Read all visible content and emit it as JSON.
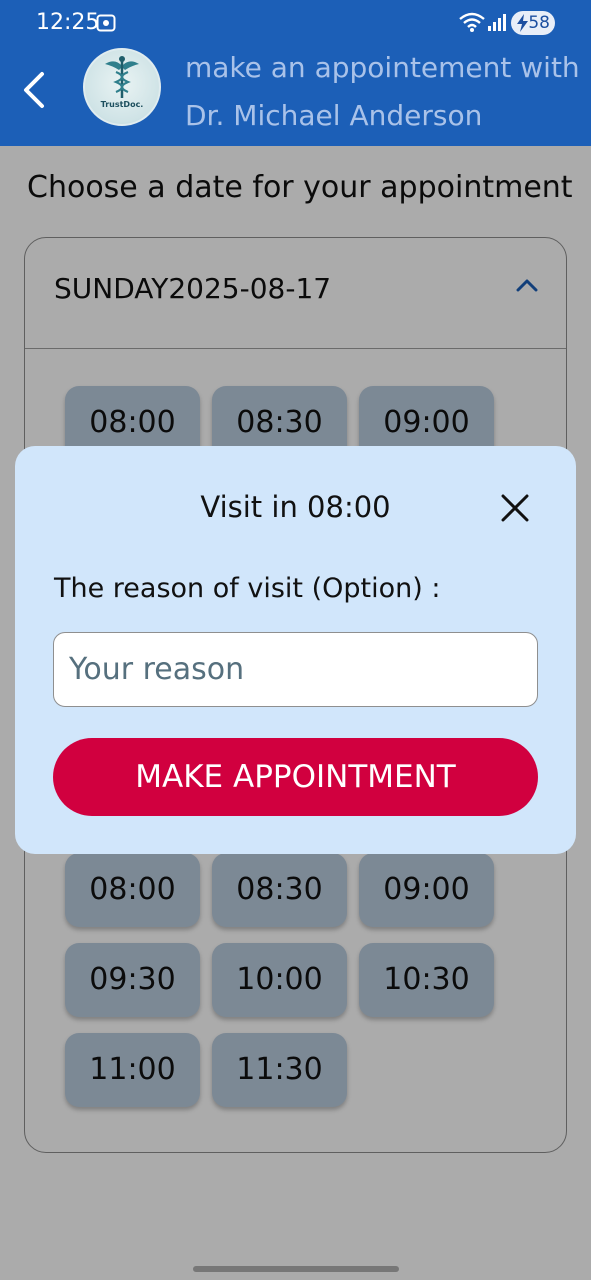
{
  "status_bar": {
    "time": "12:25",
    "battery": "58"
  },
  "app_bar": {
    "title_line1": "make an appointement with",
    "title_line2": "Dr. Michael Anderson",
    "logo_text": "TrustDoc."
  },
  "page": {
    "heading": "Choose a date for your appointment",
    "date_header": "SUNDAY2025-08-17",
    "top_slots": [
      "08:00",
      "08:30",
      "09:00"
    ],
    "slots": [
      "08:00",
      "08:30",
      "09:00",
      "09:30",
      "10:00",
      "10:30",
      "11:00",
      "11:30"
    ]
  },
  "dialog": {
    "title": "Visit in 08:00",
    "reason_label": "The reason of visit (Option) :",
    "reason_placeholder": "Your reason",
    "reason_value": "",
    "submit_label": "MAKE APPOINTMENT"
  },
  "colors": {
    "app_bar": "#1c5fb7",
    "slot": "#b9ccdf",
    "dialog_bg": "#d1e6fb",
    "button": "#d1003f"
  },
  "icons": {
    "back": "chevron-left-icon",
    "close": "close-icon",
    "expand": "chevron-up-icon",
    "wifi": "wifi-icon",
    "signal": "signal-icon",
    "battery": "battery-icon"
  }
}
